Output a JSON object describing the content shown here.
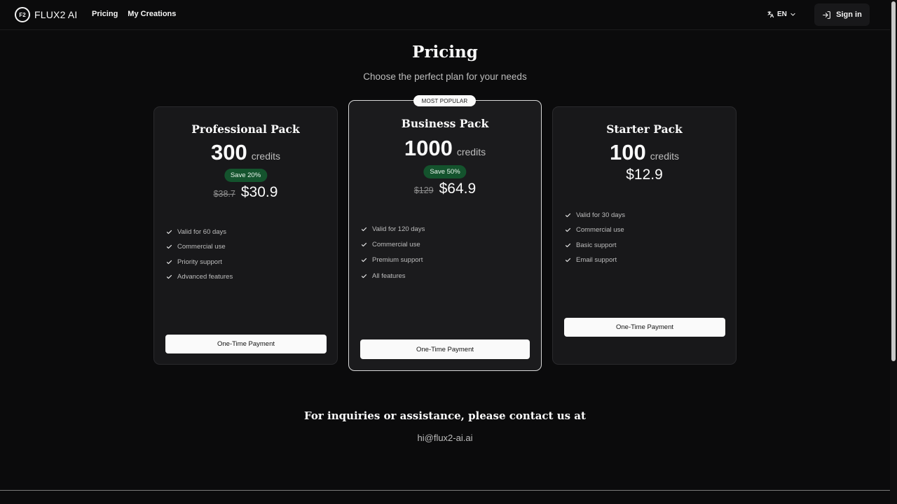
{
  "header": {
    "logo_badge": "F2",
    "brand": "FLUX2 AI",
    "nav": [
      "Pricing",
      "My Creations"
    ],
    "language": "EN",
    "signin_label": "Sign in"
  },
  "title": "Pricing",
  "subtitle": "Choose the perfect plan for your needs",
  "plans": [
    {
      "name": "Professional Pack",
      "credits": "300",
      "credits_unit": "credits",
      "save": "Save 20%",
      "old_price": "$38.7",
      "price": "$30.9",
      "features": [
        "Valid for 60 days",
        "Commercial use",
        "Priority support",
        "Advanced features"
      ],
      "button": "One-Time Payment"
    },
    {
      "name": "Business Pack",
      "badge": "MOST POPULAR",
      "credits": "1000",
      "credits_unit": "credits",
      "save": "Save 50%",
      "old_price": "$129",
      "price": "$64.9",
      "features": [
        "Valid for 120 days",
        "Commercial use",
        "Premium support",
        "All features"
      ],
      "button": "One-Time Payment"
    },
    {
      "name": "Starter Pack",
      "credits": "100",
      "credits_unit": "credits",
      "price": "$12.9",
      "features": [
        "Valid for 30 days",
        "Commercial use",
        "Basic support",
        "Email support"
      ],
      "button": "One-Time Payment"
    }
  ],
  "contact": {
    "title": "For inquiries or assistance, please contact us at",
    "email": "hi@flux2-ai.ai"
  },
  "colors": {
    "background": "#0b0b0c",
    "card": "#18181a",
    "save_badge": "#14532d",
    "button": "#fafafa"
  },
  "icons": [
    "translate-icon",
    "chevron-down-icon",
    "sign-in-icon",
    "check-icon"
  ]
}
